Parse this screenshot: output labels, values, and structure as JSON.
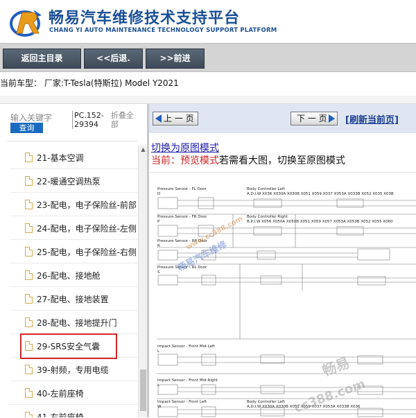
{
  "brand": {
    "title": "畅易汽车维修技术支持平台",
    "subtitle": "CHANG YI AUTO MAINTENANCE TECHNOLOGY SUPPORT PLATFORM",
    "accent": "#1a4f96"
  },
  "toolbar": {
    "home_label": "返回主目录",
    "back_label": "<<后退.",
    "forward_label": ">>前进"
  },
  "vehicle": {
    "text": "当前车型：  厂家:T-Tesla(特斯拉) Model Y2021"
  },
  "sidebar": {
    "search_placeholder": "输入关键字",
    "search_button": "查询",
    "pc_code": "PC.152-29394",
    "collapse_all": "折叠全部",
    "items": [
      {
        "label": "21-基本空调"
      },
      {
        "label": "22-暖通空调热泵"
      },
      {
        "label": "23-配电，电子保险丝-前部"
      },
      {
        "label": "24-配电，电子保险丝-左侧"
      },
      {
        "label": "25-配电，电子保险丝-右侧"
      },
      {
        "label": "26-配电、接地舱"
      },
      {
        "label": "27-配电、接地装置"
      },
      {
        "label": "28-配电、接地提升门"
      },
      {
        "label": "29-SRS安全气囊"
      },
      {
        "label": "39-射频，专用电缆"
      },
      {
        "label": "40-左前座椅"
      },
      {
        "label": "41-右前座椅"
      }
    ],
    "highlight_color": "#d42828"
  },
  "main": {
    "prev_page": "上 一 页",
    "next_page": "下 一 页",
    "refresh": "[刷新当前页]",
    "switch_link": "切换为原图模式",
    "mode_prefix": "当前：预览模式",
    "mode_suffix": "若需看大图，切换至原图模式"
  },
  "diagram": {
    "sections": [
      {
        "title": "Pressure Sensor - FL Door",
        "code": "D"
      },
      {
        "title": "Pressure Sensor - FR Door",
        "code": "P"
      },
      {
        "title": "Pressure Sensor - RR Door",
        "code": "R"
      },
      {
        "title": "Pressure Sensor - RL Door",
        "code": "S"
      },
      {
        "title": "Impact Sensor - Front Mid-Left",
        "code": "L"
      },
      {
        "title": "Impact Sensor - Front Mid-Right",
        "code": "L"
      },
      {
        "title": "Impact Sensor - Front Left",
        "code": "W"
      }
    ],
    "controllers": [
      {
        "title": "Body Controller Left",
        "pins": "A,D,I,W     X036   X030A   X030B   X051   X059   X037   X053A   X033B   X052   X035   X03B"
      },
      {
        "title": "Body Controller Right",
        "pins": "B,P,I,W     X056   X050A   X050B   X051   X059   X057   X053A   X053B   X052   X055   X060"
      },
      {
        "title": "Body Controller Left",
        "pins": "A,D,I,W  X030A   X030B   X051   X059   X037   X053A   X033B   X036"
      }
    ],
    "watermark_main": "畅易汽车维修",
    "watermark_url": "www.cc388.com",
    "watermark_corner": "畅易",
    "watermark_corner_url": "cc388.com"
  }
}
